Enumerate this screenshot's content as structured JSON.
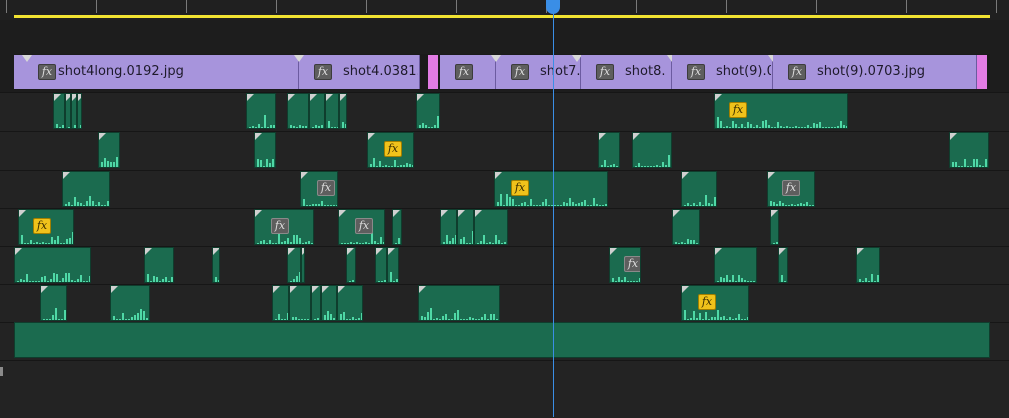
{
  "colors": {
    "work_area_bar": "#f1e332",
    "video_clip": "#a794dc",
    "transition": "#e27ce4",
    "audio_clip": "#1b6b4f",
    "waveform": "#4fd8a6",
    "playhead": "#3a8ee6",
    "fx_active": "#f0c21b",
    "fx_inactive": "#5e5e5e"
  },
  "fx_label": "fx",
  "video_clips": [
    {
      "name": "shot4long.0192.jpg"
    },
    {
      "name": "shot4.0381."
    },
    {
      "name": ""
    },
    {
      "name": "shot7."
    },
    {
      "name": "shot8."
    },
    {
      "name": "shot(9).0"
    },
    {
      "name": "shot(9).0703.jpg"
    }
  ],
  "audio_fx_badges": [
    {
      "style": "yellow"
    },
    {
      "style": "yellow"
    },
    {
      "style": "gray"
    },
    {
      "style": "yellow"
    },
    {
      "style": "gray"
    },
    {
      "style": "yellow"
    },
    {
      "style": "gray"
    },
    {
      "style": "gray"
    },
    {
      "style": "gray"
    },
    {
      "style": "yellow"
    },
    {
      "style": "yellow"
    }
  ]
}
